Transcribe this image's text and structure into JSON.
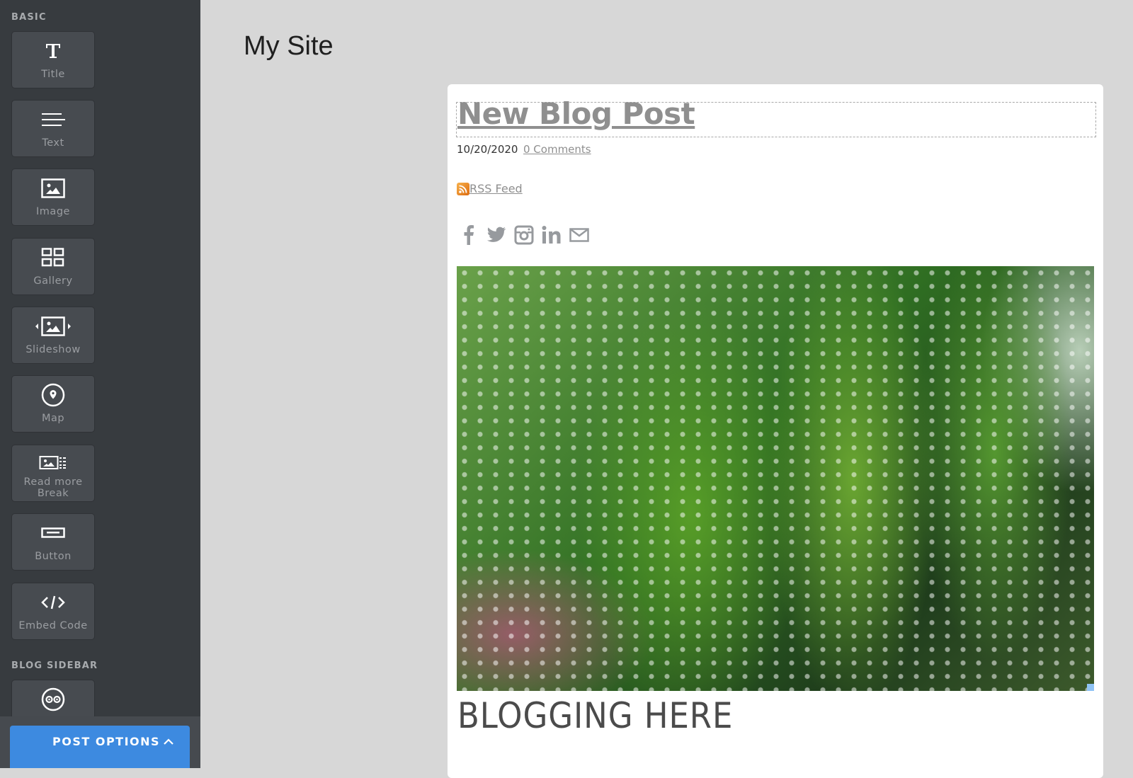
{
  "sidebar": {
    "sections": [
      {
        "label": "BASIC"
      },
      {
        "label": "BLOG SIDEBAR"
      }
    ],
    "basic_items": [
      {
        "label": "Title",
        "icon": "title-icon"
      },
      {
        "label": "Text",
        "icon": "text-icon"
      },
      {
        "label": "Image",
        "icon": "image-icon"
      },
      {
        "label": "Gallery",
        "icon": "gallery-icon"
      },
      {
        "label": "Slideshow",
        "icon": "slideshow-icon"
      },
      {
        "label": "Map",
        "icon": "map-pin-icon"
      },
      {
        "label_line1": "Read more",
        "label_line2": "Break",
        "icon": "read-more-icon"
      },
      {
        "label": "Button",
        "icon": "button-icon"
      },
      {
        "label": "Embed Code",
        "icon": "embed-code-icon"
      }
    ],
    "blog_sidebar_items": [
      {
        "label": "",
        "icon": "tripadvisor-icon"
      }
    ],
    "post_options_label": "POST OPTIONS"
  },
  "site": {
    "title": "My Site"
  },
  "post": {
    "title": "New Blog Post",
    "date": "10/20/2020",
    "comments": "0 Comments",
    "rss_label": "RSS Feed",
    "social": [
      "facebook",
      "twitter",
      "instagram",
      "linkedin",
      "email"
    ],
    "heading": "BLOGGING HERE"
  },
  "colors": {
    "accent": "#3d8ae0",
    "sidebar_bg": "#373b3f",
    "canvas_bg": "#d7d7d7"
  }
}
